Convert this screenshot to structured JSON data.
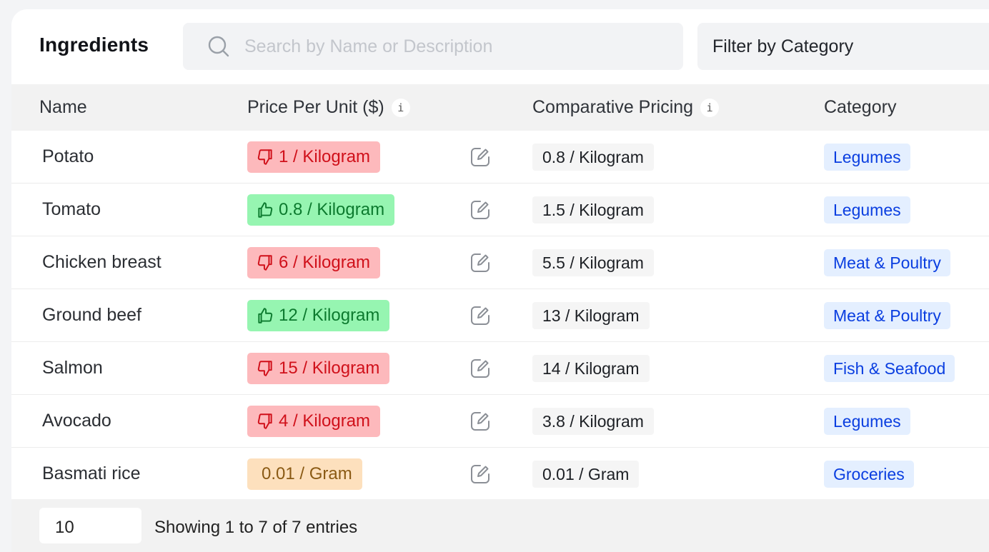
{
  "header": {
    "title": "Ingredients",
    "search_placeholder": "Search by Name or Description",
    "filter_label": "Filter by Category"
  },
  "columns": {
    "name": "Name",
    "price": "Price Per Unit ($)",
    "comparative": "Comparative Pricing",
    "category": "Category"
  },
  "rows": [
    {
      "name": "Potato",
      "price": "1 / Kilogram",
      "status": "bad",
      "comparative": "0.8 / Kilogram",
      "category": "Legumes"
    },
    {
      "name": "Tomato",
      "price": "0.8 / Kilogram",
      "status": "good",
      "comparative": "1.5 / Kilogram",
      "category": "Legumes"
    },
    {
      "name": "Chicken breast",
      "price": "6 / Kilogram",
      "status": "bad",
      "comparative": "5.5 / Kilogram",
      "category": "Meat & Poultry"
    },
    {
      "name": "Ground beef",
      "price": "12 / Kilogram",
      "status": "good",
      "comparative": "13 / Kilogram",
      "category": "Meat & Poultry"
    },
    {
      "name": "Salmon",
      "price": "15 / Kilogram",
      "status": "bad",
      "comparative": "14 / Kilogram",
      "category": "Fish & Seafood"
    },
    {
      "name": "Avocado",
      "price": "4 / Kilogram",
      "status": "bad",
      "comparative": "3.8 / Kilogram",
      "category": "Legumes"
    },
    {
      "name": "Basmati rice",
      "price": "0.01 / Gram",
      "status": "neutral",
      "comparative": "0.01 / Gram",
      "category": "Groceries"
    }
  ],
  "footer": {
    "page_size": "10",
    "showing": "Showing 1 to 7 of 7 entries"
  },
  "colors": {
    "bad_bg": "#fdb9bc",
    "good_bg": "#96f5b1",
    "neutral_bg": "#fde0bd",
    "category_bg": "#e4efff",
    "category_text": "#0a3ee0"
  },
  "icons": {
    "search": "search-icon",
    "info": "info-icon",
    "thumbs_up": "thumbs-up-icon",
    "thumbs_down": "thumbs-down-icon",
    "edit": "edit-icon"
  }
}
